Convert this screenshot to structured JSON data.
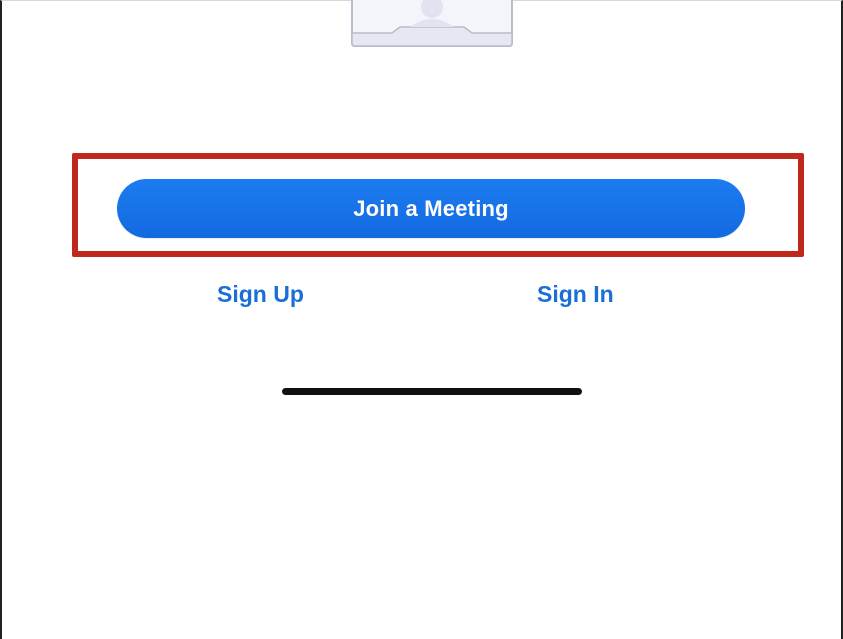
{
  "main": {
    "join_button_label": "Join a Meeting",
    "sign_up_label": "Sign Up",
    "sign_in_label": "Sign In"
  },
  "illustration": {
    "icon": "video-meeting-illustration-icon"
  },
  "colors": {
    "primary_button": "#1a73e8",
    "link": "#1a6fd6",
    "highlight_border": "#c0281d",
    "home_indicator": "#111111"
  }
}
